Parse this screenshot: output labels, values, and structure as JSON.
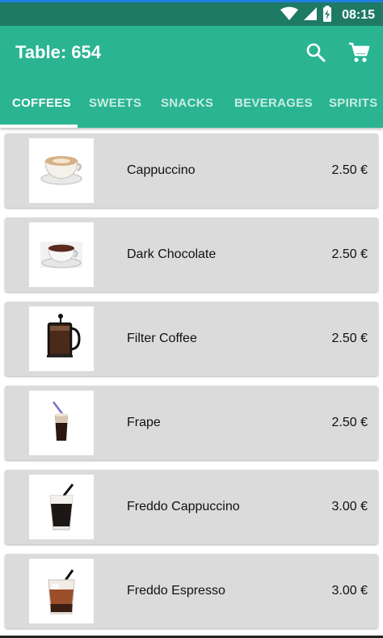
{
  "status_bar": {
    "time": "08:15",
    "icons": [
      "wifi-icon",
      "signal-icon",
      "battery-charging-icon"
    ]
  },
  "app_bar": {
    "title": "Table: 654",
    "icons": [
      "search-icon",
      "cart-icon"
    ]
  },
  "tabs": [
    {
      "label": "COFFEES",
      "active": true
    },
    {
      "label": "SWEETS",
      "active": false
    },
    {
      "label": "SNACKS",
      "active": false
    },
    {
      "label": "BEVERAGES",
      "active": false
    },
    {
      "label": "SPIRITS",
      "active": false
    }
  ],
  "items": [
    {
      "name": "Cappuccino",
      "price": "2.50 €",
      "image": "cappuccino-cup-icon"
    },
    {
      "name": "Dark Chocolate",
      "price": "2.50 €",
      "image": "hot-chocolate-cup-icon"
    },
    {
      "name": "Filter Coffee",
      "price": "2.50 €",
      "image": "french-press-icon"
    },
    {
      "name": "Frape",
      "price": "2.50 €",
      "image": "frappe-glass-icon"
    },
    {
      "name": "Freddo Cappuccino",
      "price": "3.00 €",
      "image": "freddo-cappuccino-glass-icon"
    },
    {
      "name": "Freddo Espresso",
      "price": "3.00 €",
      "image": "freddo-espresso-glass-icon"
    }
  ],
  "colors": {
    "primary": "#2ab492",
    "status_bar": "#1f7a64",
    "card": "#dbdbdb"
  }
}
